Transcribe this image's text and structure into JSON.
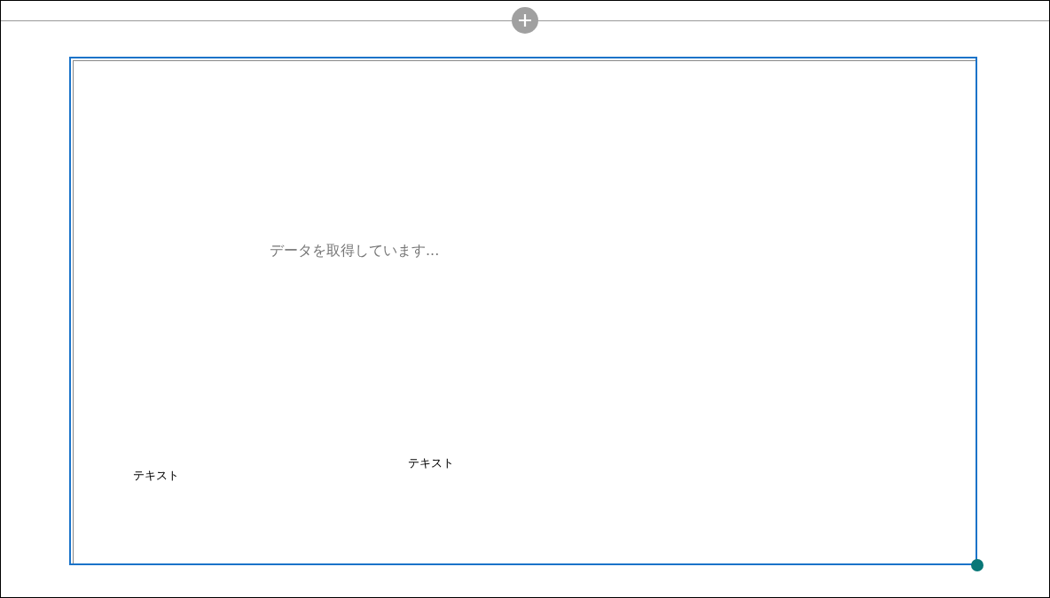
{
  "gallery": {
    "loading_message": "データを取得しています...",
    "labels": [
      {
        "text": "テキスト"
      },
      {
        "text": "テキスト"
      }
    ]
  }
}
